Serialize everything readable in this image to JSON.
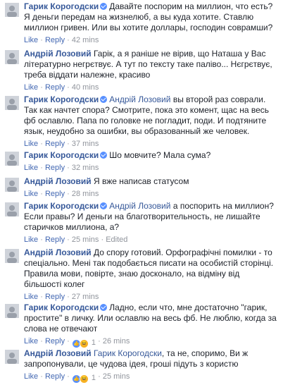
{
  "actions": {
    "like": "Like",
    "reply": "Reply",
    "edited": "Edited"
  },
  "colors": {
    "link": "#365899",
    "meta": "#90949c",
    "action": "#4267b2"
  },
  "comments": [
    {
      "author": "Гарик Корогодски",
      "verified": true,
      "mention": "",
      "text": "Давайте поспорим на миллион, что есть? Я деньги передам на жизнелюб, а вы куда хотите. Ставлю миллион гривен. Или вы хотите доллары, господин соврамши?",
      "time": "42 mins"
    },
    {
      "author": "Андрій Лозовий",
      "verified": false,
      "mention": "",
      "text": "Гарік, а я раніше не вірив, що Наташа у Вас літературно негрєтвує. А тут по тексту таке паліво... Нєгрєтвує, треба віддати належне, красиво",
      "time": "40 mins"
    },
    {
      "author": "Гарик Корогодски",
      "verified": true,
      "mention": "Андрій Лозовий",
      "text": "вы второй раз соврали. Так как начтет спора? Смотрите, пока это комент, щас на весь фб ославлю. Папа по головке не погладит, поди. И подтяните язык, неудобно за ошибки, вы образованный же человек.",
      "time": "37 mins"
    },
    {
      "author": "Гарик Корогодски",
      "verified": true,
      "mention": "",
      "text": "Шо мовчите? Мала сума?",
      "time": "32 mins"
    },
    {
      "author": "Андрій Лозовий",
      "verified": false,
      "mention": "",
      "text": "Я вже написав статусом",
      "time": "28 mins"
    },
    {
      "author": "Гарик Корогодски",
      "verified": true,
      "mention": "Андрій Лозовий",
      "text": "а поспорить на миллион? Если правы? И деньги на благотворительность, не лишайте старичков миллиона, а?",
      "time": "25 mins",
      "edited": true
    },
    {
      "author": "Андрій Лозовий",
      "verified": false,
      "mention": "",
      "text": "До спору готовий. Орфографічні помилки - то спеціально. Мені так подобається писати на особистій сторінці. Правила мови, повірте, знаю досконало, на відміну від більшості колег",
      "time": "27 mins"
    },
    {
      "author": "Гарик Корогодски",
      "verified": true,
      "mention": "",
      "text": "Ладно, если что, мне достаточно \"гарик, простите\" в личку. Или ославлю на весь фб. Не люблю, когда за слова не отвечают",
      "time": "26 mins",
      "reactions": {
        "count": "1",
        "icons": [
          "like-icon",
          "haha-icon"
        ]
      }
    },
    {
      "author": "Андрій Лозовий",
      "verified": false,
      "mention": "Гарик Корогодски",
      "text": ", та не, споримо, Ви ж запропонували, це чудова ідея, гроші підуть з користю",
      "time": "25 mins",
      "reactions": {
        "count": "1",
        "icons": [
          "like-icon",
          "haha-icon"
        ]
      }
    }
  ]
}
